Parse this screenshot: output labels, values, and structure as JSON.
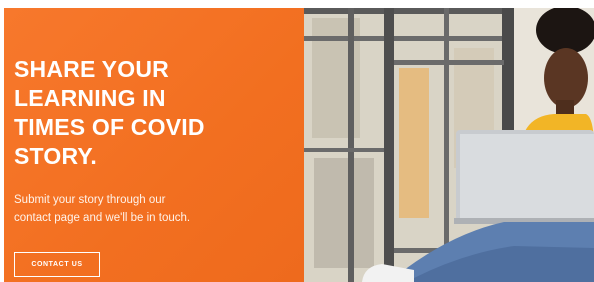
{
  "promo": {
    "headline_lines": [
      "SHARE YOUR",
      "LEARNING IN",
      "TIMES OF COVID",
      "STORY."
    ],
    "subtext_lines": [
      "Submit your story through our",
      "contact page and we'll be in touch."
    ],
    "cta_label": "CONTACT US"
  },
  "colors": {
    "accent": "#f26f20",
    "text": "#ffffff"
  },
  "photo": {
    "subject": "woman-with-laptop-by-window"
  }
}
